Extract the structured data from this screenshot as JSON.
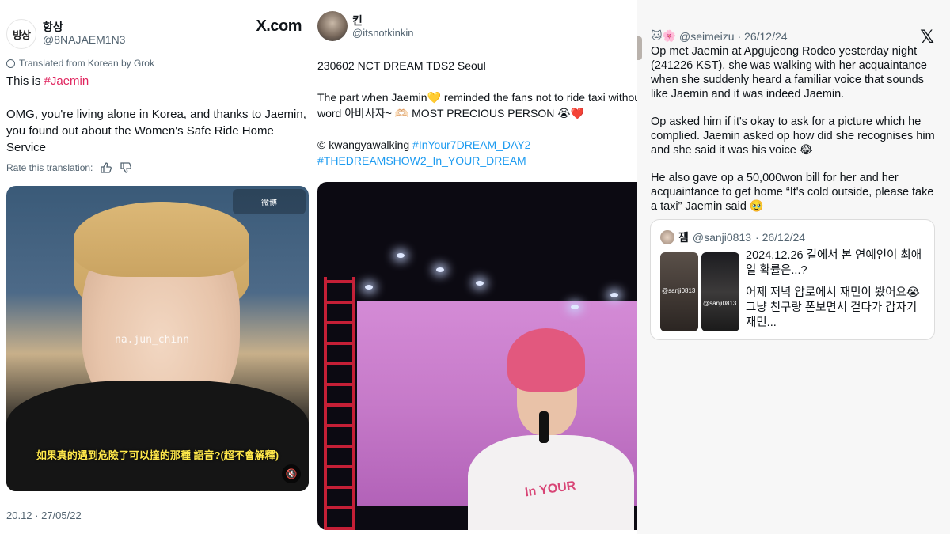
{
  "panel1": {
    "avatar_text": "방상",
    "display_name": "항상",
    "handle": "@8NAJAEM1N3",
    "brand": "X.com",
    "translated_note": "Translated from Korean by Grok",
    "line1_prefix": "This is ",
    "line1_hashtag": "#Jaemin",
    "body": "OMG, you're living alone in Korea, and thanks to Jaemin, you found out about the Women's Safe Ride Home Service",
    "rate_label": "Rate this translation:",
    "media": {
      "watermark": "na.jun_chinn",
      "weibo_tag": "微博",
      "subtitle": "如果真的遇到危險了可以撞的那種 語音?(超不會解釋)"
    },
    "timestamp": "20.12 · 27/05/22"
  },
  "panel2": {
    "display_name": "킨",
    "handle": "@itsnotkinkin",
    "line1": "230602 NCT DREAM TDS2 Seoul",
    "line2": "The part when Jaemin💛 reminded the fans not to ride taxi without",
    "line3": "word 아바사자~ 🫶🏻 MOST PRECIOUS PERSON 😭❤️",
    "credit_prefix": "© kwangyawalking ",
    "credit_hashtag": "#InYour7DREAM_DAY2",
    "hashtag2": "#THEDREAMSHOW2_In_YOUR_DREAM",
    "shirt_text": "In YOUR"
  },
  "panel3": {
    "emoji": "🐱🌸",
    "handle": "@seimeizu",
    "date": "· 26/12/24",
    "brand_glyph": "𝕏",
    "paragraphs": [
      "Op met Jaemin at Apgujeong Rodeo yesterday night (241226 KST), she was walking with her acquaintance when she suddenly heard a familiar voice that sounds like Jaemin and it was indeed Jaemin.",
      "Op asked him if it's okay to ask for a picture which he complied. Jaemin asked op how did she recognises him and she said it was his voice 😂",
      "He also gave op a 50,000won bill for her and her acquaintance to get home “It's cold outside, please take a taxi” Jaemin said 🥹"
    ],
    "quote": {
      "name": "잼",
      "handle": "@sanji0813",
      "date": "· 26/12/24",
      "image_label": "@sanji0813",
      "text1": "2024.12.26 길에서 본 연예인이 최애일 확률은...?",
      "text2": "어제 저녁 압로에서 재민이 봤어요😭 그냥 친구랑 폰보면서 걷다가 갑자기 재민..."
    }
  }
}
